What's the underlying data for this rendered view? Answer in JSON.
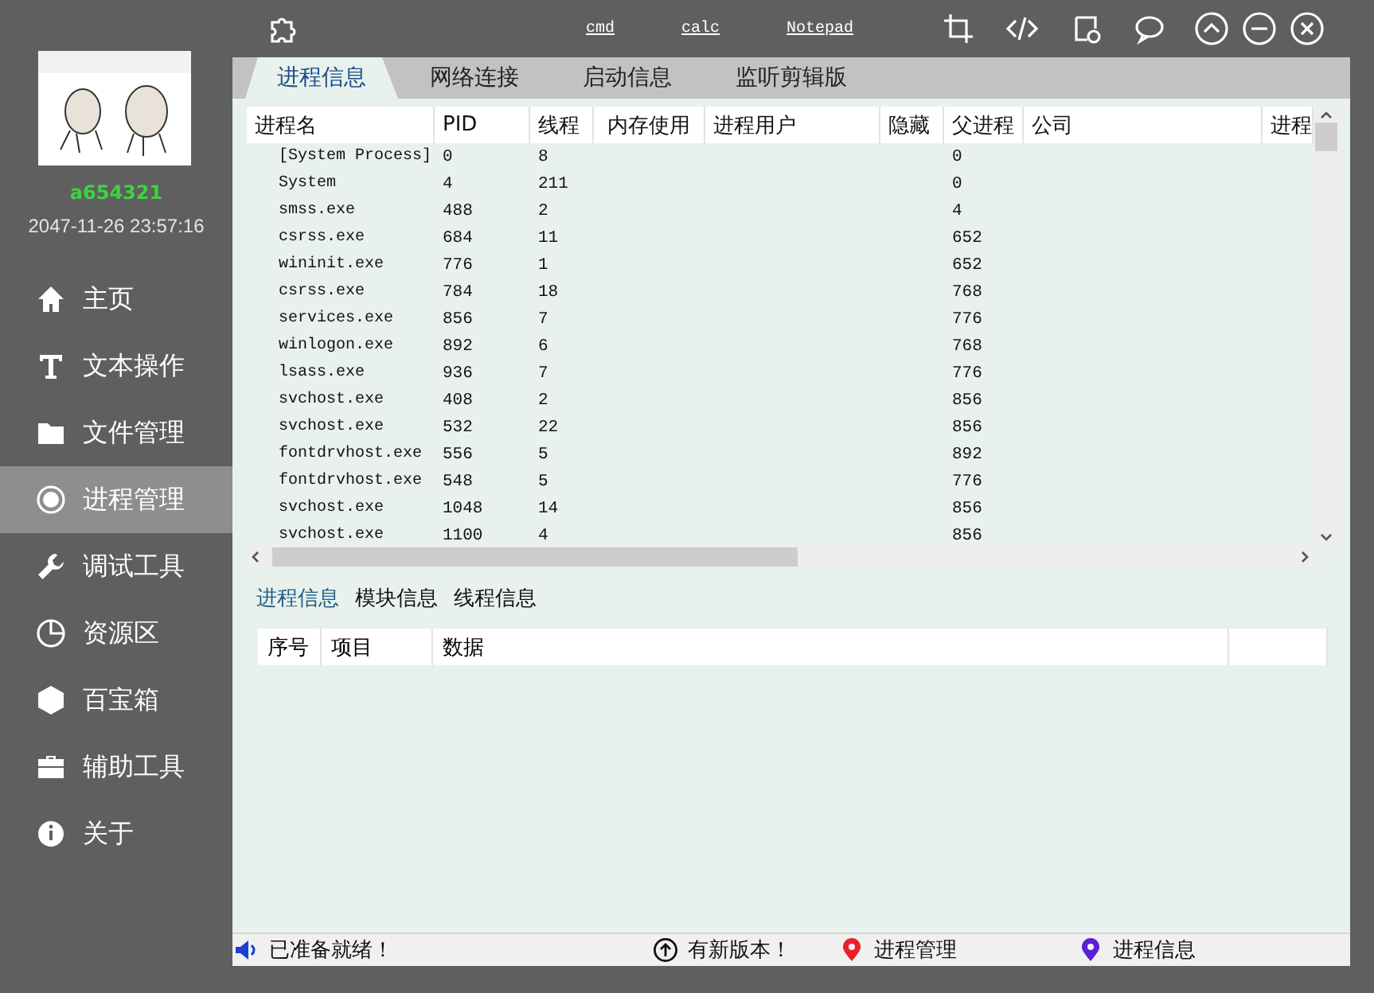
{
  "toolbar": {
    "links": [
      "cmd",
      "calc",
      "Notepad"
    ]
  },
  "user": {
    "name": "a654321",
    "datetime": "2047-11-26 23:57:16"
  },
  "sidebar": {
    "items": [
      {
        "kind": "home",
        "label": "主页",
        "selected": false
      },
      {
        "kind": "text",
        "label": "文本操作",
        "selected": false
      },
      {
        "kind": "folder",
        "label": "文件管理",
        "selected": false
      },
      {
        "kind": "target",
        "label": "进程管理",
        "selected": true
      },
      {
        "kind": "wrench",
        "label": "调试工具",
        "selected": false
      },
      {
        "kind": "pie",
        "label": "资源区",
        "selected": false
      },
      {
        "kind": "hexagon",
        "label": "百宝箱",
        "selected": false
      },
      {
        "kind": "briefcase",
        "label": "辅助工具",
        "selected": false
      },
      {
        "kind": "info",
        "label": "关于",
        "selected": false
      }
    ]
  },
  "tabs": [
    {
      "label": "进程信息",
      "selected": true
    },
    {
      "label": "网络连接",
      "selected": false
    },
    {
      "label": "启动信息",
      "selected": false
    },
    {
      "label": "监听剪辑版",
      "selected": false
    }
  ],
  "process_table": {
    "columns": [
      "进程名",
      "PID",
      "线程",
      "内存使用",
      "进程用户",
      "隐藏",
      "父进程",
      "公司",
      "进程"
    ],
    "rows": [
      {
        "name": "[System Process]",
        "pid": "0",
        "threads": "8",
        "parent": "0"
      },
      {
        "name": "System",
        "pid": "4",
        "threads": "211",
        "parent": "0"
      },
      {
        "name": "smss.exe",
        "pid": "488",
        "threads": "2",
        "parent": "4"
      },
      {
        "name": "csrss.exe",
        "pid": "684",
        "threads": "11",
        "parent": "652"
      },
      {
        "name": "wininit.exe",
        "pid": "776",
        "threads": "1",
        "parent": "652"
      },
      {
        "name": "csrss.exe",
        "pid": "784",
        "threads": "18",
        "parent": "768"
      },
      {
        "name": "services.exe",
        "pid": "856",
        "threads": "7",
        "parent": "776"
      },
      {
        "name": "winlogon.exe",
        "pid": "892",
        "threads": "6",
        "parent": "768"
      },
      {
        "name": "lsass.exe",
        "pid": "936",
        "threads": "7",
        "parent": "776"
      },
      {
        "name": "svchost.exe",
        "pid": "408",
        "threads": "2",
        "parent": "856"
      },
      {
        "name": "svchost.exe",
        "pid": "532",
        "threads": "22",
        "parent": "856"
      },
      {
        "name": "fontdrvhost.exe",
        "pid": "556",
        "threads": "5",
        "parent": "892"
      },
      {
        "name": "fontdrvhost.exe",
        "pid": "548",
        "threads": "5",
        "parent": "776"
      },
      {
        "name": "svchost.exe",
        "pid": "1048",
        "threads": "14",
        "parent": "856"
      },
      {
        "name": "svchost.exe",
        "pid": "1100",
        "threads": "4",
        "parent": "856"
      }
    ]
  },
  "detail_tabs": [
    {
      "label": "进程信息",
      "selected": true
    },
    {
      "label": "模块信息",
      "selected": false
    },
    {
      "label": "线程信息",
      "selected": false
    }
  ],
  "detail_table": {
    "columns": [
      "序号",
      "项目",
      "数据"
    ]
  },
  "status_bar": [
    {
      "kind": "speaker",
      "text": "已准备就绪！"
    },
    {
      "kind": "update",
      "text": "有新版本！"
    },
    {
      "kind": "pin",
      "text": "进程管理",
      "color": "#e8202a"
    },
    {
      "kind": "pin",
      "text": "进程信息",
      "color": "#5b1fd6"
    }
  ]
}
